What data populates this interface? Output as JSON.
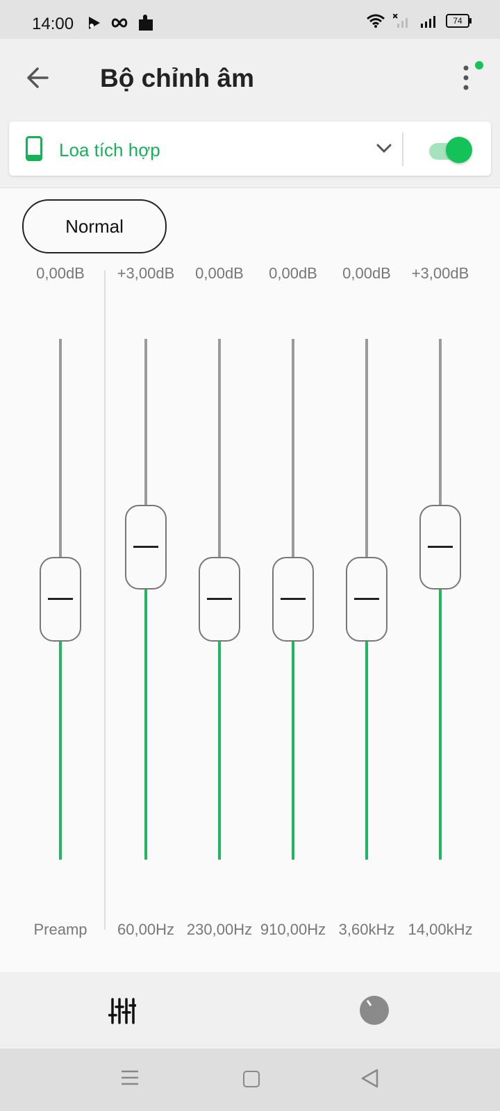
{
  "status": {
    "time": "14:00",
    "battery": "74"
  },
  "appbar": {
    "title": "Bộ chỉnh âm"
  },
  "device": {
    "name": "Loa tích hợp",
    "enabled": true
  },
  "preset": {
    "label": "Normal"
  },
  "bands": [
    {
      "gain": "0,00dB",
      "freq": "Preamp",
      "value_db": 0
    },
    {
      "gain": "+3,00dB",
      "freq": "60,00Hz",
      "value_db": 3
    },
    {
      "gain": "0,00dB",
      "freq": "230,00Hz",
      "value_db": 0
    },
    {
      "gain": "0,00dB",
      "freq": "910,00Hz",
      "value_db": 0
    },
    {
      "gain": "0,00dB",
      "freq": "3,60kHz",
      "value_db": 0
    },
    {
      "gain": "+3,00dB",
      "freq": "14,00kHz",
      "value_db": 3
    }
  ],
  "slider_range_db": [
    -15,
    15
  ],
  "colors": {
    "accent": "#14c25a",
    "track": "#9a9a9a"
  },
  "icons": {
    "back": "arrow-left-icon",
    "menu": "more-vertical-icon",
    "device": "smartphone-icon",
    "dropdown": "chevron-down-icon",
    "tab_equalizer": "equalizer-sliders-icon",
    "tab_knob": "knob-icon"
  }
}
